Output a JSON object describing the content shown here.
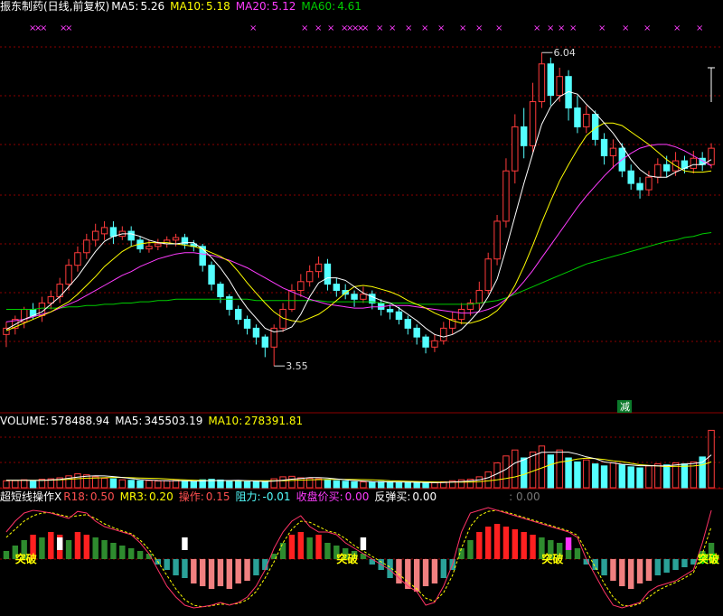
{
  "colors": {
    "up": "#ff3b3b",
    "down": "#54ffff",
    "ma5": "#ffffff",
    "ma10": "#ffff00",
    "ma20": "#ff3cff",
    "ma60": "#00cc00",
    "grid": "#8b0000",
    "label": "#ffffff"
  },
  "price_header": {
    "title": "振东制药(日线,前复权)",
    "ma5_label": "MA5:",
    "ma5_value": "5.26",
    "ma10_label": "MA10:",
    "ma10_value": "5.18",
    "ma20_label": "MA20:",
    "ma20_value": "5.12",
    "ma60_label": "MA60:",
    "ma60_value": "4.61"
  },
  "volume_header": {
    "volume_label": "VOLUME:",
    "volume_value": "578488.94",
    "ma5_label": "MA5:",
    "ma5_value": "345503.19",
    "ma10_label": "MA10:",
    "ma10_value": "278391.81"
  },
  "indicator_header": {
    "name": "超短线操作X",
    "r18_label": "R18:",
    "r18_value": "0.50",
    "mr3_label": "MR3:",
    "mr3_value": "0.20",
    "op_label": "操作:",
    "op_value": "0.15",
    "resist_label": "阻力:",
    "resist_value": "-0.01",
    "close_buy_label": "收盘价买:",
    "close_buy_value": "0.00",
    "rebound_label": "反弹买:",
    "rebound_value": "0.00",
    "extra_value": ": 0.00"
  },
  "annotations": {
    "high_label": "6.04",
    "low_label": "3.55",
    "reduce_label": "减",
    "breakout_label": "突破",
    "lock_label": "锁仓",
    "x_mark": "×"
  },
  "chart_data": [
    {
      "type": "candlestick",
      "title": "振东制药(日线,前复权)",
      "ylim": [
        3.3,
        6.3
      ],
      "high_marker": 6.04,
      "low_marker": 3.55,
      "series_names": [
        "MA5",
        "MA10",
        "MA20",
        "MA60"
      ],
      "candles": [
        [
          3.8,
          3.85,
          3.7,
          3.9
        ],
        [
          3.85,
          3.92,
          3.8,
          3.95
        ],
        [
          3.9,
          4.0,
          3.85,
          4.02
        ],
        [
          4.0,
          3.95,
          3.92,
          4.05
        ],
        [
          3.95,
          4.05,
          3.9,
          4.1
        ],
        [
          4.05,
          4.1,
          4.0,
          4.15
        ],
        [
          4.1,
          4.2,
          4.05,
          4.25
        ],
        [
          4.2,
          4.35,
          4.15,
          4.4
        ],
        [
          4.35,
          4.45,
          4.3,
          4.5
        ],
        [
          4.45,
          4.55,
          4.4,
          4.6
        ],
        [
          4.55,
          4.62,
          4.5,
          4.68
        ],
        [
          4.6,
          4.65,
          4.55,
          4.7
        ],
        [
          4.65,
          4.58,
          4.52,
          4.7
        ],
        [
          4.58,
          4.62,
          4.55,
          4.66
        ],
        [
          4.62,
          4.55,
          4.5,
          4.66
        ],
        [
          4.55,
          4.48,
          4.45,
          4.58
        ],
        [
          4.48,
          4.5,
          4.45,
          4.55
        ],
        [
          4.5,
          4.52,
          4.47,
          4.56
        ],
        [
          4.52,
          4.55,
          4.49,
          4.58
        ],
        [
          4.55,
          4.57,
          4.5,
          4.6
        ],
        [
          4.57,
          4.52,
          4.48,
          4.6
        ],
        [
          4.52,
          4.5,
          4.46,
          4.55
        ],
        [
          4.5,
          4.35,
          4.3,
          4.52
        ],
        [
          4.35,
          4.2,
          4.15,
          4.38
        ],
        [
          4.2,
          4.1,
          4.05,
          4.22
        ],
        [
          4.1,
          4.0,
          3.95,
          4.12
        ],
        [
          4.0,
          3.92,
          3.88,
          4.03
        ],
        [
          3.92,
          3.85,
          3.8,
          3.95
        ],
        [
          3.85,
          3.78,
          3.72,
          3.88
        ],
        [
          3.78,
          3.7,
          3.62,
          3.8
        ],
        [
          3.7,
          3.85,
          3.55,
          3.88
        ],
        [
          3.85,
          4.0,
          3.82,
          4.05
        ],
        [
          4.0,
          4.15,
          3.98,
          4.2
        ],
        [
          4.15,
          4.22,
          4.1,
          4.28
        ],
        [
          4.22,
          4.3,
          4.18,
          4.35
        ],
        [
          4.3,
          4.36,
          4.25,
          4.42
        ],
        [
          4.36,
          4.2,
          4.15,
          4.4
        ],
        [
          4.2,
          4.15,
          4.1,
          4.25
        ],
        [
          4.15,
          4.12,
          4.08,
          4.2
        ],
        [
          4.12,
          4.08,
          4.02,
          4.15
        ],
        [
          4.08,
          4.12,
          4.05,
          4.18
        ],
        [
          4.12,
          4.05,
          4.0,
          4.15
        ],
        [
          4.05,
          4.0,
          3.95,
          4.08
        ],
        [
          4.0,
          3.98,
          3.92,
          4.04
        ],
        [
          3.98,
          3.92,
          3.88,
          4.02
        ],
        [
          3.92,
          3.85,
          3.8,
          3.95
        ],
        [
          3.85,
          3.78,
          3.72,
          3.88
        ],
        [
          3.78,
          3.7,
          3.65,
          3.8
        ],
        [
          3.7,
          3.75,
          3.66,
          3.8
        ],
        [
          3.75,
          3.85,
          3.72,
          3.9
        ],
        [
          3.85,
          3.92,
          3.8,
          3.98
        ],
        [
          3.92,
          4.0,
          3.88,
          4.05
        ],
        [
          4.0,
          4.05,
          3.95,
          4.08
        ],
        [
          4.05,
          4.15,
          4.0,
          4.22
        ],
        [
          4.15,
          4.4,
          4.12,
          4.45
        ],
        [
          4.4,
          4.7,
          4.35,
          4.75
        ],
        [
          4.7,
          5.1,
          4.65,
          5.2
        ],
        [
          5.1,
          5.45,
          5.0,
          5.55
        ],
        [
          5.45,
          5.3,
          5.2,
          5.6
        ],
        [
          5.3,
          5.65,
          5.25,
          5.8
        ],
        [
          5.65,
          5.95,
          5.6,
          6.04
        ],
        [
          5.95,
          5.7,
          5.62,
          6.0
        ],
        [
          5.7,
          5.85,
          5.65,
          5.92
        ],
        [
          5.85,
          5.6,
          5.5,
          5.9
        ],
        [
          5.6,
          5.45,
          5.4,
          5.7
        ],
        [
          5.45,
          5.55,
          5.4,
          5.62
        ],
        [
          5.55,
          5.35,
          5.3,
          5.58
        ],
        [
          5.35,
          5.22,
          5.15,
          5.4
        ],
        [
          5.22,
          5.28,
          5.12,
          5.35
        ],
        [
          5.28,
          5.1,
          5.05,
          5.32
        ],
        [
          5.1,
          5.0,
          4.95,
          5.15
        ],
        [
          5.0,
          4.95,
          4.88,
          5.05
        ],
        [
          4.95,
          5.05,
          4.9,
          5.1
        ],
        [
          5.05,
          5.15,
          5.0,
          5.2
        ],
        [
          5.15,
          5.1,
          5.05,
          5.22
        ],
        [
          5.1,
          5.18,
          5.06,
          5.25
        ],
        [
          5.18,
          5.12,
          5.08,
          5.22
        ],
        [
          5.12,
          5.2,
          5.08,
          5.26
        ],
        [
          5.2,
          5.15,
          5.1,
          5.25
        ],
        [
          5.15,
          5.28,
          5.12,
          5.32
        ]
      ],
      "ma5": [
        3.84,
        3.88,
        3.92,
        3.95,
        3.98,
        4.04,
        4.1,
        4.18,
        4.26,
        4.36,
        4.46,
        4.54,
        4.58,
        4.6,
        4.6,
        4.58,
        4.55,
        4.53,
        4.52,
        4.52,
        4.53,
        4.53,
        4.48,
        4.41,
        4.33,
        4.23,
        4.11,
        4.01,
        3.93,
        3.85,
        3.82,
        3.83,
        3.86,
        3.96,
        4.1,
        4.21,
        4.25,
        4.25,
        4.23,
        4.18,
        4.13,
        4.1,
        4.07,
        4.05,
        4.01,
        3.96,
        3.91,
        3.85,
        3.8,
        3.78,
        3.8,
        3.84,
        3.91,
        3.99,
        4.1,
        4.24,
        4.48,
        4.74,
        5.0,
        5.24,
        5.47,
        5.61,
        5.69,
        5.73,
        5.71,
        5.63,
        5.56,
        5.48,
        5.4,
        5.3,
        5.19,
        5.11,
        5.06,
        5.05,
        5.05,
        5.09,
        5.12,
        5.15,
        5.15,
        5.19
      ],
      "ma10": [
        3.83,
        3.86,
        3.89,
        3.92,
        3.95,
        3.98,
        4.02,
        4.06,
        4.12,
        4.19,
        4.26,
        4.34,
        4.4,
        4.46,
        4.5,
        4.52,
        4.53,
        4.53,
        4.53,
        4.52,
        4.51,
        4.5,
        4.48,
        4.45,
        4.42,
        4.38,
        4.3,
        4.21,
        4.13,
        4.05,
        3.98,
        3.93,
        3.91,
        3.9,
        3.93,
        3.96,
        4.01,
        4.07,
        4.13,
        4.18,
        4.19,
        4.18,
        4.16,
        4.14,
        4.11,
        4.07,
        4.04,
        4.01,
        3.97,
        3.94,
        3.91,
        3.89,
        3.89,
        3.91,
        3.94,
        3.99,
        4.07,
        4.19,
        4.34,
        4.51,
        4.69,
        4.86,
        5.02,
        5.15,
        5.27,
        5.38,
        5.44,
        5.48,
        5.48,
        5.46,
        5.41,
        5.36,
        5.31,
        5.25,
        5.19,
        5.14,
        5.1,
        5.09,
        5.09,
        5.1
      ],
      "ma20": [
        3.9,
        3.91,
        3.92,
        3.94,
        3.96,
        3.98,
        4.01,
        4.04,
        4.07,
        4.11,
        4.15,
        4.19,
        4.23,
        4.27,
        4.3,
        4.34,
        4.37,
        4.4,
        4.42,
        4.44,
        4.45,
        4.45,
        4.44,
        4.43,
        4.41,
        4.39,
        4.36,
        4.33,
        4.29,
        4.25,
        4.21,
        4.17,
        4.14,
        4.11,
        4.08,
        4.06,
        4.04,
        4.03,
        4.02,
        4.01,
        4.01,
        4.02,
        4.02,
        4.03,
        4.03,
        4.03,
        4.02,
        4.01,
        4.0,
        3.99,
        3.98,
        3.97,
        3.97,
        3.98,
        4.0,
        4.03,
        4.08,
        4.14,
        4.22,
        4.31,
        4.41,
        4.51,
        4.61,
        4.71,
        4.81,
        4.9,
        4.98,
        5.06,
        5.13,
        5.19,
        5.24,
        5.28,
        5.3,
        5.31,
        5.31,
        5.29,
        5.26,
        5.22,
        5.18,
        5.14
      ],
      "ma60": [
        4.0,
        4.0,
        4.0,
        4.0,
        4.01,
        4.01,
        4.01,
        4.02,
        4.02,
        4.03,
        4.03,
        4.04,
        4.04,
        4.05,
        4.05,
        4.06,
        4.06,
        4.07,
        4.07,
        4.08,
        4.08,
        4.08,
        4.08,
        4.08,
        4.08,
        4.08,
        4.08,
        4.08,
        4.07,
        4.07,
        4.07,
        4.07,
        4.07,
        4.07,
        4.07,
        4.07,
        4.06,
        4.06,
        4.06,
        4.06,
        4.06,
        4.06,
        4.05,
        4.05,
        4.05,
        4.05,
        4.04,
        4.04,
        4.04,
        4.04,
        4.04,
        4.04,
        4.04,
        4.05,
        4.06,
        4.07,
        4.09,
        4.12,
        4.15,
        4.18,
        4.21,
        4.24,
        4.27,
        4.3,
        4.33,
        4.36,
        4.38,
        4.4,
        4.42,
        4.44,
        4.46,
        4.48,
        4.5,
        4.52,
        4.54,
        4.55,
        4.57,
        4.58,
        4.6,
        4.61
      ]
    },
    {
      "type": "bar",
      "title": "VOLUME",
      "series_names": [
        "VOLUME",
        "MA5",
        "MA10"
      ],
      "volume": [
        70,
        72,
        80,
        65,
        85,
        90,
        100,
        120,
        140,
        130,
        110,
        95,
        90,
        80,
        75,
        70,
        72,
        68,
        70,
        74,
        66,
        60,
        80,
        85,
        78,
        70,
        66,
        60,
        62,
        58,
        90,
        110,
        115,
        100,
        95,
        90,
        80,
        70,
        66,
        60,
        58,
        56,
        62,
        60,
        55,
        52,
        50,
        48,
        52,
        60,
        70,
        80,
        85,
        110,
        160,
        250,
        320,
        380,
        300,
        360,
        420,
        330,
        380,
        300,
        260,
        280,
        240,
        220,
        250,
        230,
        210,
        200,
        220,
        240,
        230,
        250,
        240,
        260,
        310,
        578
      ],
      "ma5": [
        75,
        75,
        75,
        74,
        74,
        78,
        84,
        95,
        107,
        116,
        120,
        119,
        113,
        104,
        94,
        82,
        77,
        73,
        71,
        71,
        70,
        66,
        68,
        72,
        73,
        73,
        75,
        71,
        67,
        63,
        67,
        76,
        86,
        94,
        102,
        102,
        97,
        89,
        80,
        73,
        67,
        62,
        60,
        58,
        57,
        56,
        55,
        53,
        51,
        52,
        56,
        62,
        69,
        79,
        101,
        141,
        185,
        249,
        282,
        322,
        356,
        356,
        358,
        358,
        338,
        311,
        293,
        259,
        250,
        236,
        230,
        222,
        222,
        220,
        220,
        230,
        238,
        244,
        256,
        331
      ],
      "ma10": [
        75,
        75,
        75,
        75,
        75,
        76,
        79,
        85,
        91,
        96,
        98,
        101,
        104,
        105,
        101,
        97,
        95,
        93,
        88,
        83,
        79,
        76,
        73,
        72,
        72,
        72,
        71,
        71,
        71,
        70,
        70,
        71,
        74,
        77,
        80,
        82,
        83,
        84,
        84,
        83,
        82,
        80,
        76,
        71,
        68,
        65,
        63,
        60,
        58,
        56,
        56,
        57,
        57,
        61,
        69,
        79,
        93,
        109,
        134,
        167,
        199,
        233,
        258,
        271,
        289,
        297,
        293,
        284,
        271,
        263,
        246,
        232,
        225,
        219,
        213,
        216,
        216,
        219,
        229,
        260
      ],
      "ylim": [
        0,
        600
      ]
    },
    {
      "type": "bar",
      "title": "超短线操作X",
      "series_names": [
        "R18",
        "MR3",
        "操作",
        "阻力"
      ],
      "hist": [
        0.15,
        0.25,
        0.35,
        0.45,
        0.4,
        0.5,
        0.45,
        0.35,
        0.5,
        0.45,
        0.4,
        0.35,
        0.3,
        0.25,
        0.2,
        0.15,
        0.1,
        -0.1,
        -0.2,
        -0.3,
        -0.35,
        -0.45,
        -0.5,
        -0.55,
        -0.5,
        -0.55,
        -0.45,
        -0.4,
        -0.3,
        -0.2,
        0.1,
        0.3,
        0.45,
        0.5,
        0.4,
        0.45,
        0.3,
        0.25,
        0.2,
        0.15,
        0.1,
        -0.1,
        -0.2,
        -0.35,
        -0.45,
        -0.55,
        -0.6,
        -0.5,
        -0.45,
        -0.35,
        -0.2,
        0.2,
        0.35,
        0.5,
        0.6,
        0.65,
        0.6,
        0.55,
        0.5,
        0.45,
        0.4,
        0.35,
        0.3,
        0.25,
        0.2,
        -0.1,
        -0.2,
        -0.3,
        -0.4,
        -0.5,
        -0.55,
        -0.45,
        -0.4,
        -0.3,
        -0.25,
        -0.2,
        -0.15,
        -0.1,
        0.15,
        0.3
      ],
      "r18": [
        0.5,
        0.7,
        0.85,
        0.9,
        0.88,
        0.85,
        0.8,
        0.75,
        0.88,
        0.85,
        0.7,
        0.6,
        0.55,
        0.5,
        0.45,
        0.3,
        0.1,
        -0.2,
        -0.5,
        -0.7,
        -0.85,
        -0.9,
        -0.88,
        -0.85,
        -0.8,
        -0.85,
        -0.8,
        -0.7,
        -0.5,
        -0.2,
        0.2,
        0.5,
        0.7,
        0.8,
        0.6,
        0.5,
        0.5,
        0.45,
        0.3,
        0.2,
        0.1,
        0.0,
        -0.1,
        -0.2,
        -0.35,
        -0.5,
        -0.6,
        -0.85,
        -0.8,
        -0.5,
        -0.1,
        0.5,
        0.85,
        0.9,
        0.95,
        0.9,
        0.85,
        0.8,
        0.75,
        0.7,
        0.65,
        0.6,
        0.55,
        0.5,
        0.4,
        0.0,
        -0.3,
        -0.6,
        -0.85,
        -0.9,
        -0.85,
        -0.8,
        -0.6,
        -0.5,
        -0.45,
        -0.4,
        -0.3,
        -0.2,
        0.3,
        0.9
      ],
      "mr3": [
        0.4,
        0.55,
        0.7,
        0.8,
        0.85,
        0.86,
        0.82,
        0.78,
        0.8,
        0.82,
        0.75,
        0.65,
        0.58,
        0.52,
        0.47,
        0.35,
        0.18,
        -0.05,
        -0.3,
        -0.55,
        -0.75,
        -0.85,
        -0.88,
        -0.86,
        -0.83,
        -0.84,
        -0.82,
        -0.75,
        -0.6,
        -0.35,
        -0.05,
        0.3,
        0.55,
        0.7,
        0.68,
        0.6,
        0.52,
        0.48,
        0.38,
        0.25,
        0.15,
        0.05,
        -0.05,
        -0.15,
        -0.28,
        -0.42,
        -0.55,
        -0.72,
        -0.78,
        -0.62,
        -0.3,
        0.2,
        0.6,
        0.8,
        0.88,
        0.9,
        0.87,
        0.82,
        0.77,
        0.72,
        0.67,
        0.62,
        0.57,
        0.52,
        0.44,
        0.15,
        -0.15,
        -0.45,
        -0.7,
        -0.85,
        -0.87,
        -0.82,
        -0.7,
        -0.58,
        -0.5,
        -0.43,
        -0.35,
        -0.25,
        0.1,
        0.6
      ],
      "signals": [
        {
          "i": 2,
          "type": "breakout"
        },
        {
          "i": 38,
          "type": "breakout"
        },
        {
          "i": 61,
          "type": "breakout"
        },
        {
          "i": 84,
          "type": "lock"
        },
        {
          "i": 99,
          "type": "breakout"
        }
      ],
      "ylim": [
        -1,
        1
      ]
    }
  ]
}
